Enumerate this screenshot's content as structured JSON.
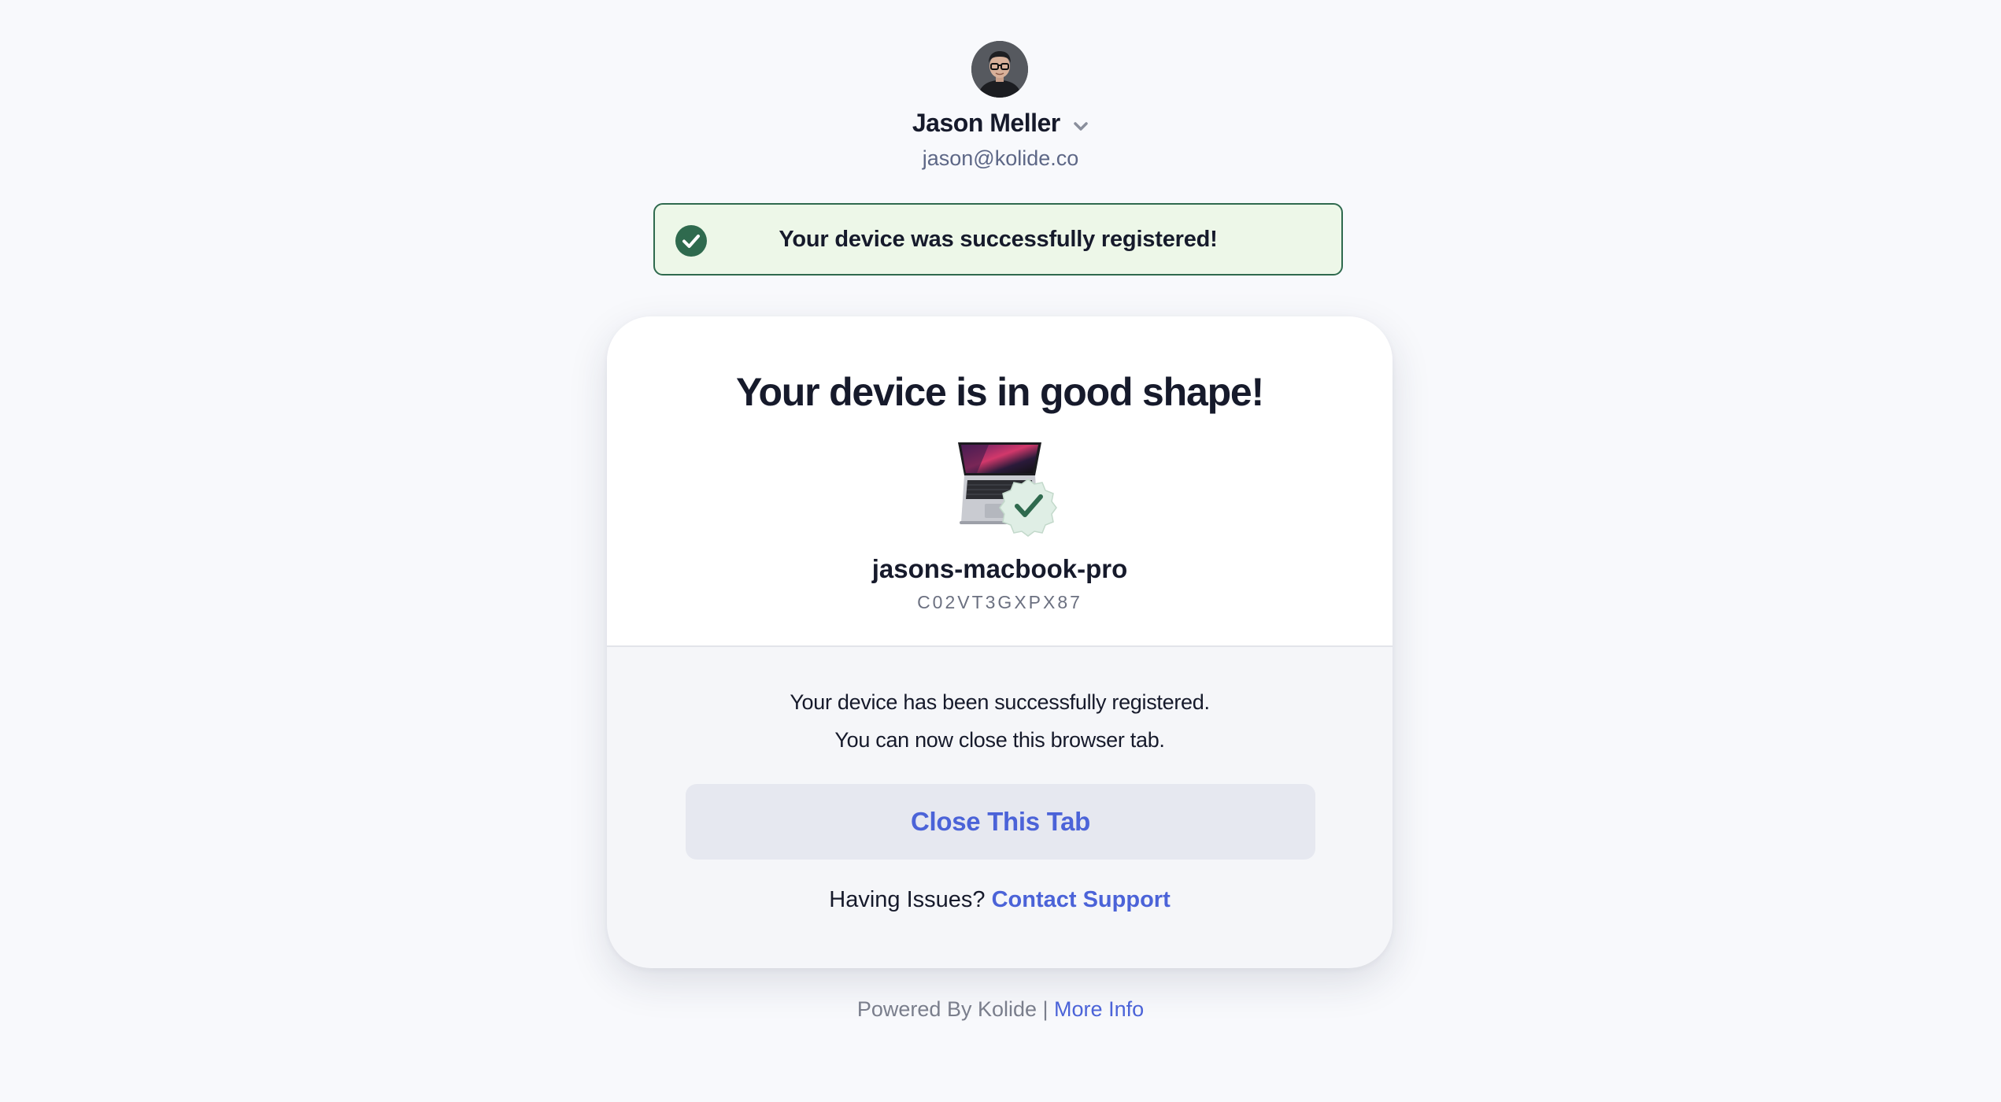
{
  "user": {
    "name": "Jason Meller",
    "email": "jason@kolide.co",
    "avatar_icon": "user-avatar",
    "menu_icon": "chevron-down-icon"
  },
  "banner": {
    "message": "Your device was successfully registered!",
    "icon": "check-circle-icon",
    "background": "#edf7e8",
    "border_color": "#2f6a4e"
  },
  "card": {
    "title": "Your device is in good shape!",
    "device_icon": "laptop-verified-icon",
    "device_name": "jasons-macbook-pro",
    "device_serial": "C02VT3GXPX87",
    "info_line_1": "Your device has been successfully registered.",
    "info_line_2": "You can now close this browser tab.",
    "close_button_label": "Close This Tab",
    "issues_text": "Having Issues?",
    "support_link_label": "Contact Support"
  },
  "footer": {
    "powered_by": "Powered By Kolide |",
    "more_info_label": "More Info"
  },
  "colors": {
    "accent": "#4b63d8",
    "page_background": "#f8f9fc",
    "success_green": "#2f6a4e"
  }
}
